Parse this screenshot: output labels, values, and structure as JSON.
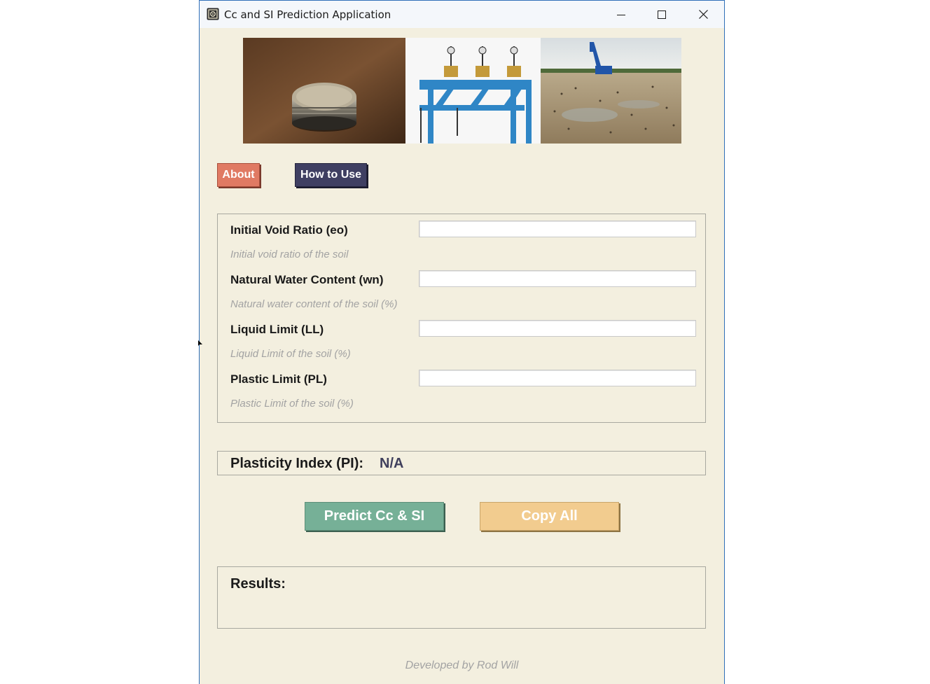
{
  "window": {
    "title": "Cc and SI Prediction Application",
    "controls": {
      "minimize": "minimize-icon",
      "maximize": "maximize-icon",
      "close": "close-icon"
    }
  },
  "banner": {
    "images": [
      "soil-specimen-photo",
      "consolidation-apparatus-photo",
      "construction-site-photo"
    ]
  },
  "nav": {
    "about_label": "About",
    "howto_label": "How to Use"
  },
  "inputs": [
    {
      "label": "Initial Void Ratio (eo)",
      "hint": "Initial void ratio of the soil",
      "value": ""
    },
    {
      "label": "Natural Water Content (wn)",
      "hint": "Natural water content of the soil (%)",
      "value": ""
    },
    {
      "label": "Liquid Limit (LL)",
      "hint": "Liquid Limit of the soil (%)",
      "value": ""
    },
    {
      "label": "Plastic Limit (PL)",
      "hint": "Plastic Limit of the soil (%)",
      "value": ""
    }
  ],
  "plasticity": {
    "label": "Plasticity Index (PI):",
    "value": "N/A"
  },
  "actions": {
    "predict_label": "Predict Cc & SI",
    "copy_label": "Copy All"
  },
  "results": {
    "label": "Results:"
  },
  "footer": {
    "credit": "Developed by Rod Will"
  },
  "colors": {
    "background": "#f3efdf",
    "about": "#e07a63",
    "howto": "#3f3f62",
    "predict": "#76b097",
    "copy": "#f2cc8f",
    "pi_value": "#3f3f5c",
    "hint": "#a3a3a3"
  }
}
